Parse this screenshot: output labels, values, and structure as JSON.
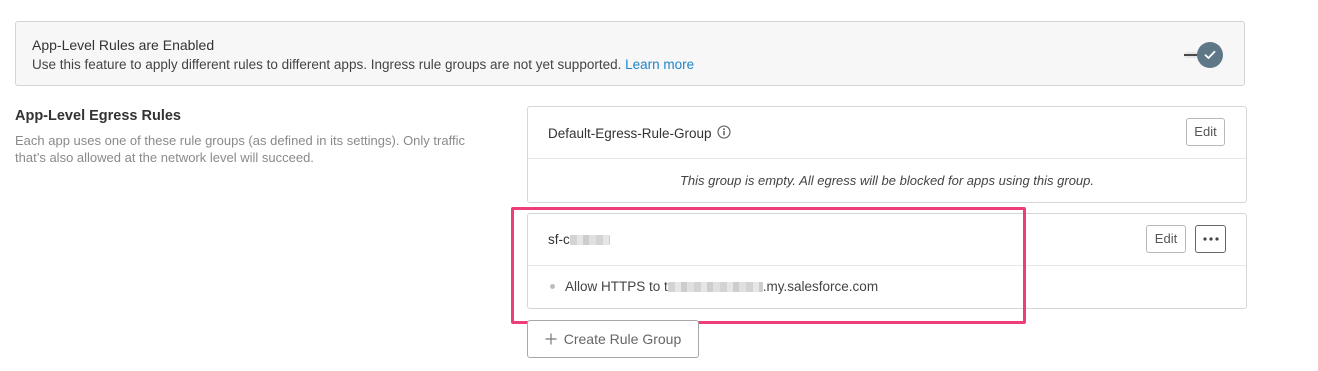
{
  "banner": {
    "title": "App-Level Rules are Enabled",
    "description": "Use this feature to apply different rules to different apps. Ingress rule groups are not yet supported.",
    "link_text": "Learn more",
    "toggle_state": "on",
    "toggle_icon": "check-icon"
  },
  "section": {
    "title": "App-Level Egress Rules",
    "description": "Each app uses one of these rule groups (as defined in its settings). Only traffic that’s also allowed at the network level will succeed."
  },
  "rule_groups": [
    {
      "name": "Default-Egress-Rule-Group",
      "edit_label": "Edit",
      "empty_message": "This group is empty. All egress will be blocked for apps using this group."
    },
    {
      "name_prefix": "sf-c",
      "edit_label": "Edit",
      "more_icon": "ellipsis-icon",
      "rules": [
        {
          "prefix": "Allow HTTPS to t",
          "suffix": ".my.salesforce.com"
        }
      ]
    }
  ],
  "create_button": {
    "label": "Create Rule Group",
    "icon": "plus-icon"
  },
  "colors": {
    "accent_link": "#1e86c8",
    "toggle_knob": "#5e7888",
    "highlight": "#ee3d7b"
  }
}
